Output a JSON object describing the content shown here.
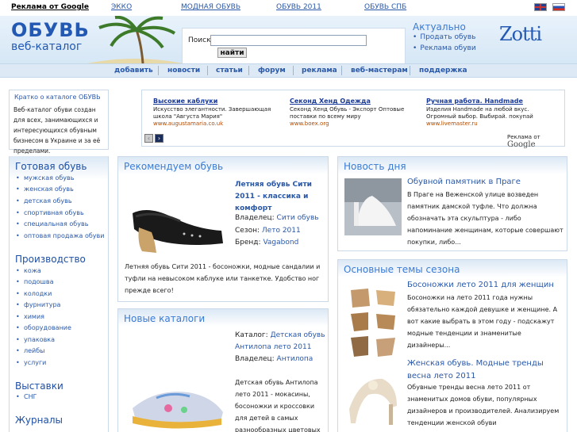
{
  "topbar": {
    "ads_by_google": "Реклама от Google",
    "links": [
      "ЭККО",
      "МОДНАЯ ОБУВЬ",
      "ОБУВЬ 2011",
      "ОБУВЬ СПБ"
    ]
  },
  "header": {
    "logo_title": "ОБУВЬ",
    "logo_subtitle": "веб-каталог",
    "search_label": "Поиск",
    "search_value": "",
    "search_button": "найти",
    "aktual_title": "Актуально",
    "aktual_items": [
      "Продать обувь",
      "Реклама обуви"
    ],
    "brand": "Zotti"
  },
  "nav": [
    "добавить",
    "новости",
    "статьи",
    "форум",
    "реклама",
    "веб-мастерам",
    "поддержка"
  ],
  "about": {
    "title": "Кратко о каталоге ОБУВЬ",
    "body": "Веб-каталог обуви создан для всех, занимающихся и интересующихся обувным бизнесом в Украине и за её пределами."
  },
  "ads": [
    {
      "title": "Высокие каблуки",
      "desc": "Искусство элегантности. Завершающая школа \"Августа Мария\"",
      "url": "www.augustamaria.co.uk"
    },
    {
      "title": "Секонд Хенд Одежда",
      "desc": "Секонд Хенд Обувь - Экспорт Оптовые поставки по всему миру",
      "url": "www.boex.org"
    },
    {
      "title": "Ручная работа. Handmade",
      "desc": "Изделия Handmade на любой вкус. Огромный выбор. Выбирай. покупай",
      "url": "www.livemaster.ru"
    }
  ],
  "ads_footer": {
    "prefix": "Реклама от",
    "brand": "Google"
  },
  "left": {
    "gotovaya": {
      "title": "Готовая обувь",
      "items": [
        "мужская обувь",
        "женская обувь",
        "детская обувь",
        "спортивная обувь",
        "специальная обувь",
        "оптовая продажа обуви"
      ]
    },
    "proizv": {
      "title": "Производство",
      "items": [
        "кожа",
        "подошва",
        "колодки",
        "фурнитура",
        "химия",
        "оборудование",
        "упаковка",
        "лейбы",
        "услуги"
      ]
    },
    "vystavki": {
      "title": "Выставки",
      "items": [
        "СНГ"
      ]
    },
    "zhurnaly": {
      "title": "Журналы"
    }
  },
  "recommend": {
    "title": "Рекомендуем обувь",
    "product": "Летняя обувь Сити 2011 - классика и комфорт",
    "owner_label": "Владелец:",
    "owner": "Сити обувь",
    "season_label": "Сезон:",
    "season": "Лето 2011",
    "brand_label": "Бренд:",
    "brand": "Vagabond",
    "desc": "Летняя обувь Сити 2011 - босоножки, модные сандалии и туфли на невысоком каблуке или танкетке. Удобство ног прежде всего!"
  },
  "catalogs": {
    "title": "Новые каталоги",
    "catalog_label": "Каталог:",
    "catalog": "Детская обувь Антилопа лето 2011",
    "owner_label": "Владелец:",
    "owner": "Антилопа",
    "desc": "Детская обувь Антилопа лето 2011 - мокасины, босоножки и кроссовки для детей в самых разнообразных цветовых"
  },
  "news": {
    "title": "Новость дня",
    "headline": "Обувной памятник в Праге",
    "body": "В Праге на Веженской улице возведен памятник дамской туфле. Что должна обозначать эта скульптура - либо напоминание женщинам, которые совершают покупки, либо..."
  },
  "themes": {
    "title": "Основные темы сезона",
    "item1_title": "Босоножки лето 2011 для женщин",
    "item1_body": "Босоножки на лето 2011 года нужны обязательно каждой девушке и женщине. А вот какие выбрать в этом году - подскажут модные тенденции и знаменитые дизайнеры...",
    "item2_title": "Женская обувь. Модные тренды весна лето 2011",
    "item2_body": "Обувные тренды весна лето 2011 от знаменитых домов обуви, популярных дизайнеров и производителей. Анализируем тенденции женской обуви"
  }
}
